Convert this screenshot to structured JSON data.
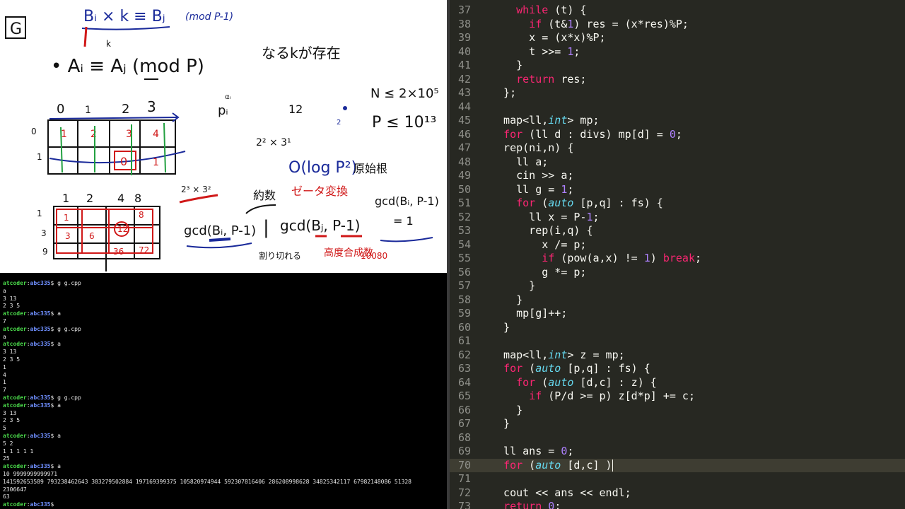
{
  "whiteboard": {
    "label_g": "G",
    "eq1": "Bᵢ × k ≡ Bⱼ",
    "eq1_mod": "(mod P-1)",
    "k_note": "k",
    "eq2": "•  Aᵢ  ≡ Aⱼ  (mod P)",
    "eq2_jp": "なるkが存在",
    "n_limit": "N ≤ 2×10⁵",
    "p_limit": "P ≤ 10¹³",
    "grid_top_headers": [
      "0",
      "1",
      "2",
      "3"
    ],
    "grid_top_rows": [
      "0",
      "1"
    ],
    "grid_bottom_headers": [
      "1",
      "2",
      "4",
      "8"
    ],
    "grid_bottom_rows": [
      "1",
      "3",
      "9"
    ],
    "pi_note": "pᵢ",
    "pi_sup": "αᵢ",
    "twelve": "12",
    "two": "2",
    "factor": "2² × 3¹",
    "complexity": "O(log P²)",
    "primitive_root": "原始根",
    "factor2": "2³ × 3²",
    "divisor": "約数",
    "zeta": "ゼータ変換",
    "gcd1": "gcd(Bᵢ, P-1)",
    "gcd2": "gcd(Bⱼ, P-1)",
    "divides": "割り切れる",
    "highly_composite": "高度合成数",
    "hc_value": "10080",
    "gcd3": "gcd(Bᵢ, P-1)",
    "gcd3_val": "= 1"
  },
  "terminal": {
    "user": "atcoder",
    "path": "abc335",
    "lines": [
      {
        "type": "prompt",
        "cmd": "g g.cpp"
      },
      {
        "type": "out",
        "text": "a"
      },
      {
        "type": "out",
        "text": "3 13"
      },
      {
        "type": "out",
        "text": "2 3 5"
      },
      {
        "type": "prompt",
        "cmd": "a"
      },
      {
        "type": "out",
        "text": "7"
      },
      {
        "type": "prompt",
        "cmd": "g g.cpp"
      },
      {
        "type": "out",
        "text": "a"
      },
      {
        "type": "prompt",
        "cmd": "a"
      },
      {
        "type": "out",
        "text": "3 13"
      },
      {
        "type": "out",
        "text": "2 3 5"
      },
      {
        "type": "out",
        "text": "1"
      },
      {
        "type": "out",
        "text": "4"
      },
      {
        "type": "out",
        "text": "1"
      },
      {
        "type": "out",
        "text": "7"
      },
      {
        "type": "prompt",
        "cmd": "g g.cpp"
      },
      {
        "type": "prompt",
        "cmd": "a"
      },
      {
        "type": "out",
        "text": "3 13"
      },
      {
        "type": "out",
        "text": "2 3 5"
      },
      {
        "type": "out",
        "text": "5"
      },
      {
        "type": "prompt",
        "cmd": "a"
      },
      {
        "type": "out",
        "text": "5 2"
      },
      {
        "type": "out",
        "text": "1 1 1 1 1"
      },
      {
        "type": "out",
        "text": "25"
      },
      {
        "type": "prompt",
        "cmd": "a"
      },
      {
        "type": "out",
        "text": "10 9999999999971"
      },
      {
        "type": "out",
        "text": "141592653589 793238462643 383279502884 197169399375 105820974944 592307816406 286208998628 34825342117 67982148086 51328"
      },
      {
        "type": "out",
        "text": "2306647"
      },
      {
        "type": "out",
        "text": "63"
      },
      {
        "type": "prompt",
        "cmd": ""
      }
    ]
  },
  "editor": {
    "current_line": "70",
    "lines": [
      {
        "n": "37",
        "html": "    <span class=\"kw\">while</span> (t) {"
      },
      {
        "n": "38",
        "html": "      <span class=\"kw\">if</span> (t&amp;<span class=\"nm\">1</span>) res = (x*res)%P;"
      },
      {
        "n": "39",
        "html": "      x = (x*x)%P;"
      },
      {
        "n": "40",
        "html": "      t &gt;&gt;= <span class=\"nm\">1</span>;"
      },
      {
        "n": "41",
        "html": "    }"
      },
      {
        "n": "42",
        "html": "    <span class=\"kw\">return</span> res;"
      },
      {
        "n": "43",
        "html": "  };"
      },
      {
        "n": "44",
        "html": ""
      },
      {
        "n": "45",
        "html": "  map&lt;ll,<span class=\"ty\">int</span>&gt; mp;"
      },
      {
        "n": "46",
        "html": "  <span class=\"kw\">for</span> (ll d : divs) mp[d] = <span class=\"nm\">0</span>;"
      },
      {
        "n": "47",
        "html": "  rep(ni,n) {"
      },
      {
        "n": "48",
        "html": "    ll a;"
      },
      {
        "n": "49",
        "html": "    cin &gt;&gt; a;"
      },
      {
        "n": "50",
        "html": "    ll g = <span class=\"nm\">1</span>;"
      },
      {
        "n": "51",
        "html": "    <span class=\"kw\">for</span> (<span class=\"ty\">auto</span> [p,q] : fs) {"
      },
      {
        "n": "52",
        "html": "      ll x = P-<span class=\"nm\">1</span>;"
      },
      {
        "n": "53",
        "html": "      rep(i,q) {"
      },
      {
        "n": "54",
        "html": "        x /= p;"
      },
      {
        "n": "55",
        "html": "        <span class=\"kw\">if</span> (pow(a,x) != <span class=\"nm\">1</span>) <span class=\"kw\">break</span>;"
      },
      {
        "n": "56",
        "html": "        g *= p;"
      },
      {
        "n": "57",
        "html": "      }"
      },
      {
        "n": "58",
        "html": "    }"
      },
      {
        "n": "59",
        "html": "    mp[g]++;"
      },
      {
        "n": "60",
        "html": "  }"
      },
      {
        "n": "61",
        "html": ""
      },
      {
        "n": "62",
        "html": "  map&lt;ll,<span class=\"ty\">int</span>&gt; z = mp;"
      },
      {
        "n": "63",
        "html": "  <span class=\"kw\">for</span> (<span class=\"ty\">auto</span> [p,q] : fs) {"
      },
      {
        "n": "64",
        "html": "    <span class=\"kw\">for</span> (<span class=\"ty\">auto</span> [d,c] : z) {"
      },
      {
        "n": "65",
        "html": "      <span class=\"kw\">if</span> (P/d &gt;= p) z[d*p] += c;"
      },
      {
        "n": "66",
        "html": "    }"
      },
      {
        "n": "67",
        "html": "  }"
      },
      {
        "n": "68",
        "html": ""
      },
      {
        "n": "69",
        "html": "  ll ans = <span class=\"nm\">0</span>;"
      },
      {
        "n": "70",
        "html": "  <span class=\"kw\">for</span> (<span class=\"ty\">auto</span> [d,c] )"
      },
      {
        "n": "71",
        "html": ""
      },
      {
        "n": "72",
        "html": "  cout &lt;&lt; ans &lt;&lt; endl;"
      },
      {
        "n": "73",
        "html": "  <span class=\"kw\">return</span> <span class=\"nm\">0</span>;"
      }
    ]
  },
  "colors": {
    "editor_bg": "#272822",
    "keyword": "#f92672",
    "type": "#66d9ef",
    "number": "#ae81ff",
    "ink_blue": "#1a2a9a",
    "ink_red": "#d01818",
    "ink_green": "#22a040"
  }
}
